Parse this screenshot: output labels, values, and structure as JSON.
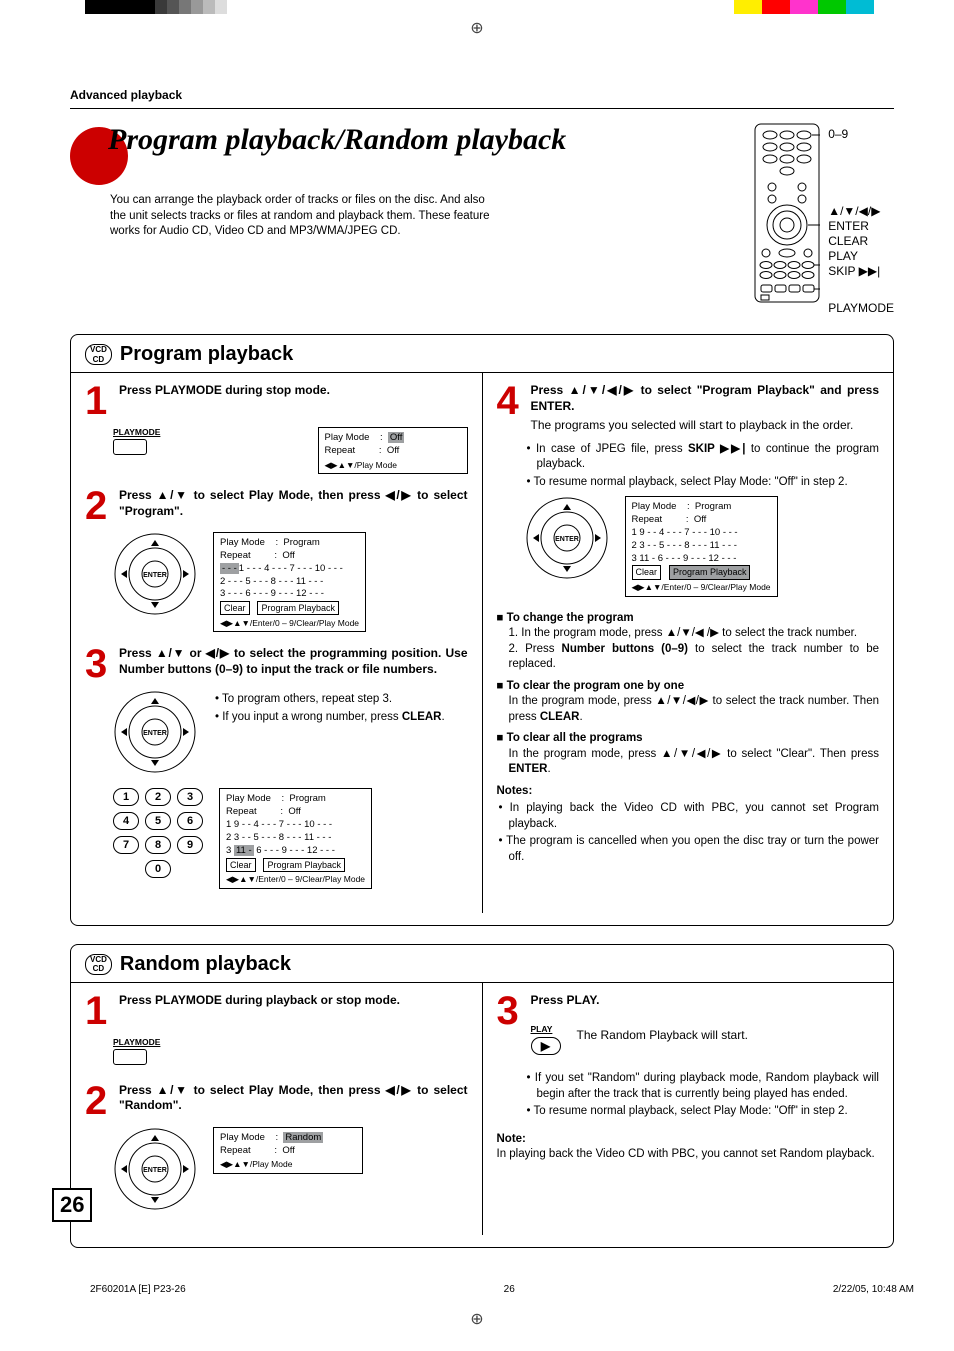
{
  "header": "Advanced playback",
  "title": "Program playback/Random playback",
  "intro": "You can arrange the playback order of tracks or files on the disc. And also the unit selects tracks or files at random and playback them. These feature works for Audio CD, Video CD and MP3/WMA/JPEG CD.",
  "remote": {
    "num": "0–9",
    "arrows": "▲/▼/◀/▶",
    "enter": "ENTER",
    "clear": "CLEAR",
    "play": "PLAY",
    "skip": "SKIP ▶▶|",
    "playmode": "PLAYMODE"
  },
  "section1": {
    "title": "Program playback",
    "badge_top": "VCD",
    "badge_bot": "CD",
    "step1": "Press PLAYMODE during stop mode.",
    "step1_lbl": "PLAYMODE",
    "osd1": {
      "l1": "Play Mode",
      "v1": "Off",
      "l2": "Repeat",
      "v2": "Off",
      "foot": "◀▶▲▼/Play Mode"
    },
    "step2": "Press ▲/▼ to select Play Mode, then press ◀/▶ to select \"Program\".",
    "osd2": {
      "l1": "Play Mode",
      "v1": "Program",
      "l2": "Repeat",
      "v2": "Off",
      "rows": [
        "1 - - -    4 - - -    7 - - -    10 - - -",
        "2 - - -    5 - - -    8 - - -    11 - - -",
        "3 - - -    6 - - -    9 - - -    12 - - -"
      ],
      "clear": "Clear",
      "pp": "Program Playback",
      "foot": "◀▶▲▼/Enter/0 – 9/Clear/Play Mode"
    },
    "step3": "Press ▲/▼ or ◀/▶ to select the programming position. Use Number buttons (0–9) to input the track or file numbers.",
    "step3_b1": "To program others, repeat step 3.",
    "step3_b2a": "If you input a wrong number, press ",
    "step3_b2b": "CLEAR",
    "step3_b2c": ".",
    "osd3": {
      "l1": "Play Mode",
      "v1": "Program",
      "l2": "Repeat",
      "v2": "Off",
      "rows": [
        "1 9 - -    4 - - -    7 - - -    10 - - -",
        "2 3 - -    5 - - -    8 - - -    11 - - -"
      ],
      "row3a": "3 ",
      "row3b": "11 -",
      "row3c": "    6 - - -    9 - - -    12 - - -",
      "clear": "Clear",
      "pp": "Program Playback",
      "foot": "◀▶▲▼/Enter/0 – 9/Clear/Play Mode"
    },
    "step4": "Press ▲/▼/◀/▶ to select \"Program Playback\" and press ENTER.",
    "step4_sub": "The programs you selected will start to playback in the order.",
    "step4_b1a": "In case of JPEG file, press ",
    "step4_b1b": "SKIP ▶▶|",
    "step4_b1c": " to continue the program playback.",
    "step4_b2": "To resume normal playback, select Play Mode: \"Off\" in step 2.",
    "osd4": {
      "l1": "Play Mode",
      "v1": "Program",
      "l2": "Repeat",
      "v2": "Off",
      "rows": [
        "1 9 - -    4 - - -    7 - - -    10 - - -",
        "2 3 - -    5 - - -    8 - - -    11 - - -",
        "3 11 -    6 - - -    9 - - -    12 - - -"
      ],
      "clear": "Clear",
      "pp": "Program Playback",
      "foot": "◀▶▲▼/Enter/0 – 9/Clear/Play Mode"
    },
    "change_h": "To change the program",
    "change_1": "1. In the program mode, press ▲/▼/◀ /▶ to select the track number.",
    "change_2a": "2. Press ",
    "change_2b": "Number buttons (0–9)",
    "change_2c": " to select the track number to be replaced.",
    "clearone_h": "To clear the program one by one",
    "clearone_a": "In the program mode, press ▲/▼/◀/▶ to select the track number. Then press ",
    "clearone_b": "CLEAR",
    "clearone_c": ".",
    "clearall_h": "To clear all the programs",
    "clearall_a": "In the program mode, press ▲/▼/◀/▶ to select \"Clear\". Then press ",
    "clearall_b": "ENTER",
    "clearall_c": ".",
    "notes_h": "Notes:",
    "notes_1": "In playing back the Video CD with PBC, you cannot set Program playback.",
    "notes_2": "The program is cancelled when you open the disc tray or turn the power off."
  },
  "section2": {
    "title": "Random playback",
    "step1": "Press PLAYMODE during playback or stop mode.",
    "step1_lbl": "PLAYMODE",
    "step2": "Press ▲/▼ to select Play Mode, then press ◀/▶ to select \"Random\".",
    "osd": {
      "l1": "Play Mode",
      "v1": "Random",
      "l2": "Repeat",
      "v2": "Off",
      "foot": "◀▶▲▼/Play Mode"
    },
    "step3": "Press PLAY.",
    "step3_lbl": "PLAY",
    "step3_sub": "The Random Playback will start.",
    "b1": "If you set \"Random\" during playback mode, Random playback will begin after the track that is currently being played has ended.",
    "b2": "To resume normal playback, select Play Mode: \"Off\" in step 2.",
    "note_h": "Note:",
    "note": "In playing back the Video CD with PBC, you cannot set Random playback."
  },
  "pagenum": "26",
  "footer": {
    "l": "2F60201A [E] P23-26",
    "c": "26",
    "r": "2/22/05, 10:48 AM"
  }
}
